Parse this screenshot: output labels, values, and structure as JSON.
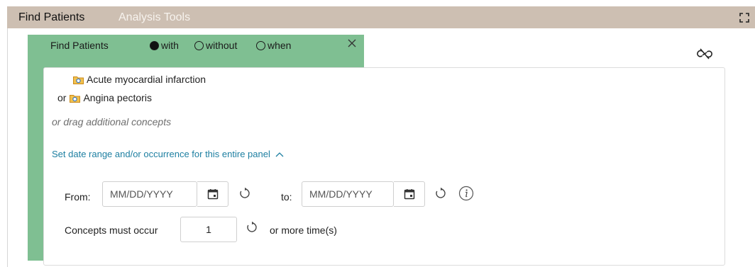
{
  "tabs": {
    "find_patients": "Find Patients",
    "analysis_tools": "Analysis Tools"
  },
  "panel": {
    "title": "Find Patients",
    "options": [
      {
        "label": "with",
        "selected": true
      },
      {
        "label": "without",
        "selected": false
      },
      {
        "label": "when",
        "selected": false
      }
    ],
    "concepts": [
      {
        "prefix": "",
        "label": "Acute myocardial infarction",
        "icon": "folder-icon"
      },
      {
        "prefix": "or",
        "label": "Angina pectoris",
        "icon": "folder-icon"
      }
    ],
    "drag_hint": "or drag additional concepts",
    "date_range_link": "Set date range and/or occurrence for this entire panel",
    "from_label": "From:",
    "from_placeholder": "MM/DD/YYYY",
    "to_label": "to:",
    "to_placeholder": "MM/DD/YYYY",
    "occur_label": "Concepts must occur",
    "occur_value": "1",
    "occur_suffix": "or more time(s)"
  },
  "colors": {
    "tab_bar": "#cdbfb2",
    "panel_accent": "#7fbf92",
    "link": "#1d7fa1"
  }
}
